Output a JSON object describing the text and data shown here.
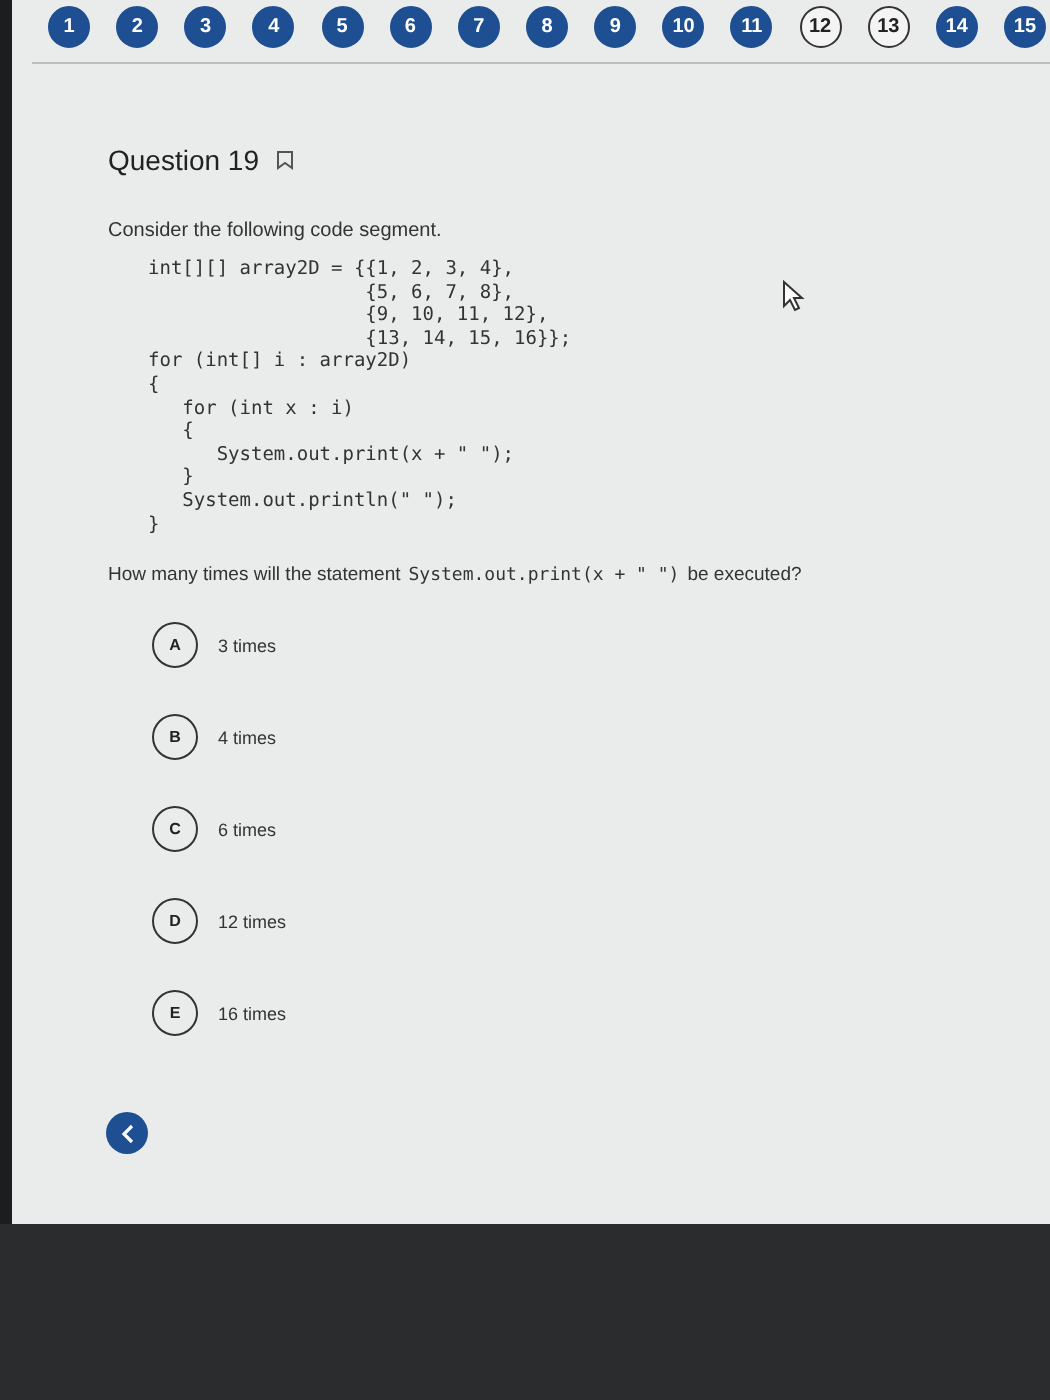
{
  "question_nav": [
    {
      "label": "1",
      "answered": true
    },
    {
      "label": "2",
      "answered": true
    },
    {
      "label": "3",
      "answered": true
    },
    {
      "label": "4",
      "answered": true
    },
    {
      "label": "5",
      "answered": true
    },
    {
      "label": "6",
      "answered": true
    },
    {
      "label": "7",
      "answered": true
    },
    {
      "label": "8",
      "answered": true
    },
    {
      "label": "9",
      "answered": true
    },
    {
      "label": "10",
      "answered": true
    },
    {
      "label": "11",
      "answered": true
    },
    {
      "label": "12",
      "answered": false
    },
    {
      "label": "13",
      "answered": false
    },
    {
      "label": "14",
      "answered": true
    },
    {
      "label": "15",
      "answered": true
    }
  ],
  "question": {
    "title": "Question 19",
    "bookmarked": false,
    "intro": "Consider the following code segment.",
    "code": [
      "int[][] array2D = {{1, 2, 3, 4},",
      "                   {5, 6, 7, 8},",
      "                   {9, 10, 11, 12},",
      "                   {13, 14, 15, 16}};",
      "for (int[] i : array2D)",
      "{",
      "   for (int x : i)",
      "   {",
      "      System.out.print(x + \" \");",
      "   }",
      "   System.out.println(\" \");",
      "}"
    ],
    "prompt_before": "How many times will the statement",
    "prompt_code": "System.out.print(x + \" \")",
    "prompt_after": "be executed?",
    "options": [
      {
        "letter": "A",
        "text": "3 times",
        "selected": false
      },
      {
        "letter": "B",
        "text": "4 times",
        "selected": false
      },
      {
        "letter": "C",
        "text": "6 times",
        "selected": false
      },
      {
        "letter": "D",
        "text": "12 times",
        "selected": false
      },
      {
        "letter": "E",
        "text": "16 times",
        "selected": false
      }
    ]
  }
}
